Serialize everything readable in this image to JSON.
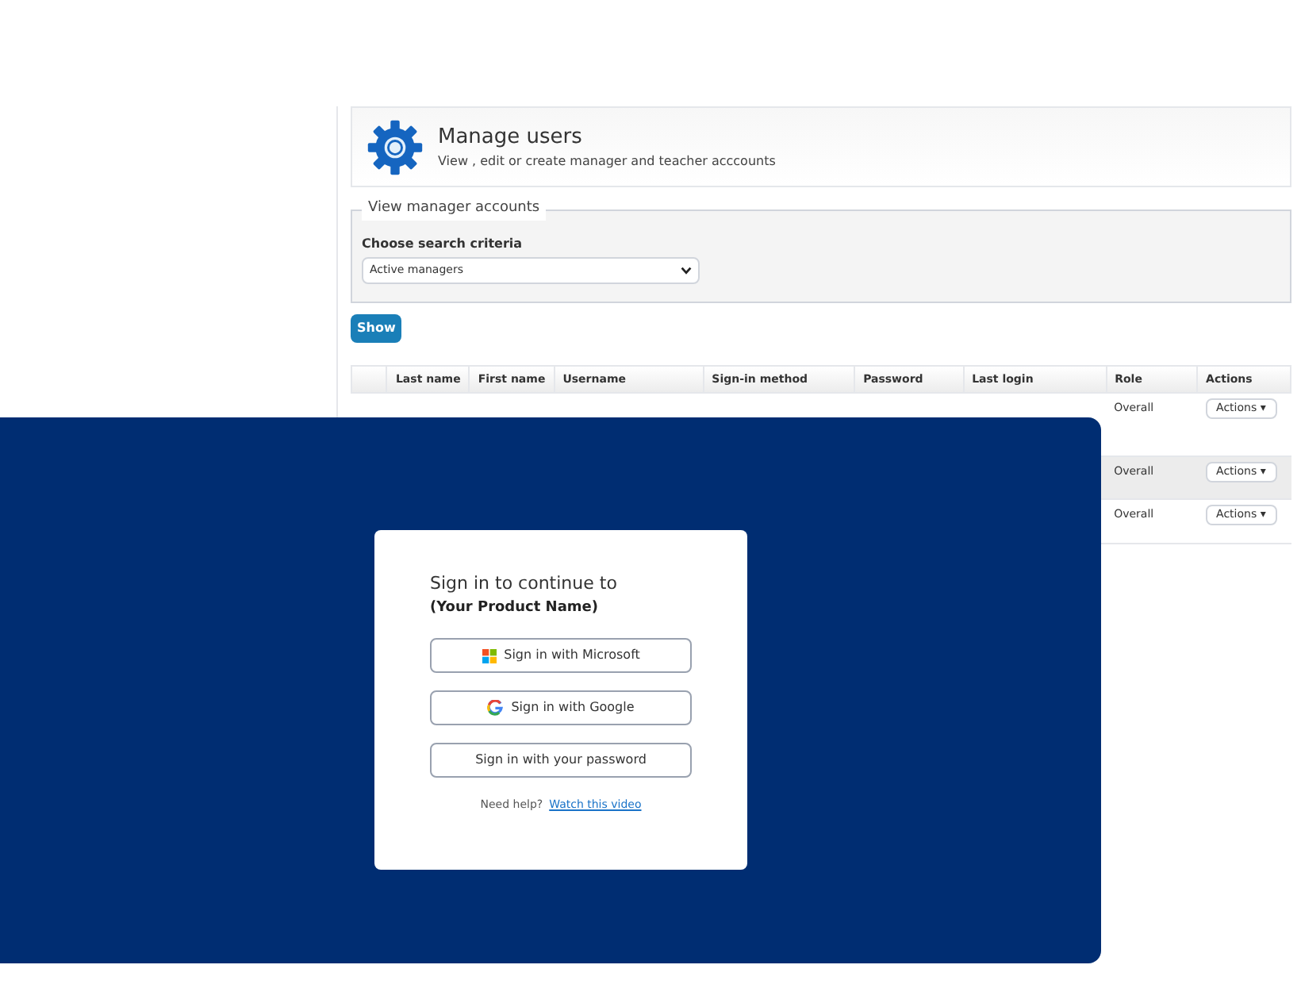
{
  "header": {
    "title": "Manage users",
    "subtitle": "View , edit or create manager and teacher acccounts"
  },
  "filter": {
    "legend": "View manager accounts",
    "label": "Choose search criteria",
    "value": "Active managers"
  },
  "show_button": "Show",
  "table": {
    "columns": [
      "Last name",
      "First name",
      "Username",
      "Sign-in method",
      "Password",
      "Last login",
      "Role",
      "Actions"
    ],
    "rows": [
      {
        "role": "Overall",
        "action": "Actions ▾"
      },
      {
        "role": "Overall",
        "action": "Actions ▾"
      },
      {
        "role": "Overall",
        "action": "Actions ▾"
      }
    ]
  },
  "signin": {
    "title": "Sign in to continue to",
    "product": "(Your Product Name)",
    "buttons": [
      {
        "kind": "microsoft",
        "label": "Sign in with Microsoft"
      },
      {
        "kind": "google",
        "label": "Sign in with Google"
      },
      {
        "kind": "password",
        "label": "Sign in with your password"
      }
    ],
    "help": "Need help?",
    "link": "Watch this video"
  }
}
